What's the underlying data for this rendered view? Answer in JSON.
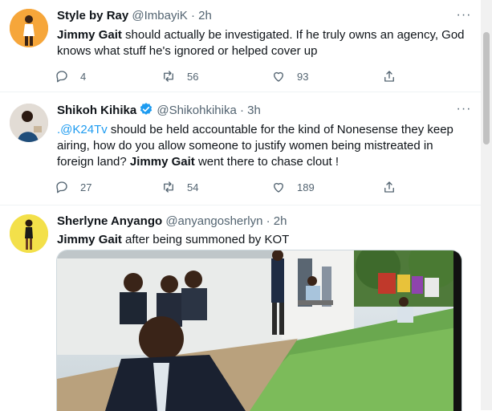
{
  "tweets": [
    {
      "name": "Style by Ray",
      "handle": "@ImbayiK",
      "time": "· 2h",
      "text": "should actually be investigated. If he truly owns an agency, God knows what stuff he's ignored or helped cover up",
      "bold_lead": "Jimmy Gait",
      "replies": "4",
      "retweets": "56",
      "likes": "93"
    },
    {
      "name": "Shikoh Kihika",
      "handle": "@Shikohkihika",
      "time": "· 3h",
      "mention": ".@K24Tv",
      "text_part1": " should be held accountable for the kind of Nonesense they keep airing, how do you allow someone to justify women being mistreated   in foreign land? ",
      "bold_mid": "Jimmy Gait",
      "text_part2": " went there to chase clout !",
      "replies": "27",
      "retweets": "54",
      "likes": "189"
    },
    {
      "name": "Sherlyne Anyango",
      "handle": "@anyangosherlyn",
      "time": "· 2h",
      "bold_lead": "Jimmy Gait",
      "text": " after being summoned by KOT"
    }
  ],
  "more_glyph": "···",
  "icons": [
    "reply-icon",
    "retweet-icon",
    "like-icon",
    "share-icon",
    "verified-badge-icon",
    "more-icon"
  ],
  "colors": {
    "accent": "#1d9bf0",
    "muted": "#536471",
    "text": "#0f1419",
    "divider": "#eff3f4"
  }
}
